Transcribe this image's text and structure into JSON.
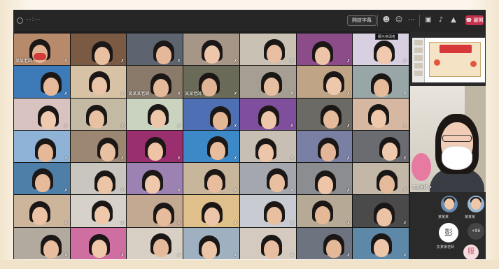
{
  "window": {
    "title": "--:--",
    "top_button": "開啟字幕",
    "leave_label": "離開"
  },
  "tooltip": "顯示參與者",
  "icons": [
    "participants-icon",
    "reactions-icon",
    "more-icon",
    "camera-icon",
    "mic-icon",
    "share-icon",
    "phone-icon"
  ],
  "tiles": [
    {
      "label": "某某老師",
      "bg": "#b88a6c",
      "skin": "#e0b392",
      "mask": true
    },
    {
      "label": "",
      "bg": "#7b5a43",
      "skin": "#e8c0a0"
    },
    {
      "label": "",
      "bg": "#5d6470",
      "skin": "#e6b89a"
    },
    {
      "label": "",
      "bg": "#a59687",
      "skin": "#edc6ab"
    },
    {
      "label": "",
      "bg": "#c8c1b4",
      "skin": "#e9bfa3"
    },
    {
      "label": "",
      "bg": "#8c4c8a",
      "skin": "#eec4a8"
    },
    {
      "label": "",
      "bg": "#d8cfe0",
      "skin": "#f0c9ae"
    },
    {
      "label": "",
      "bg": "#3c7ab8",
      "skin": "#e6b99a"
    },
    {
      "label": "",
      "bg": "#d7c2a6",
      "skin": "#eac4a6"
    },
    {
      "label": "黃某某老師",
      "bg": "#8a7a6a",
      "skin": "#e4ba9b"
    },
    {
      "label": "某某老師",
      "bg": "#6a6a58",
      "skin": "#dfb595"
    },
    {
      "label": "",
      "bg": "#a69e92",
      "skin": "#e7bea0"
    },
    {
      "label": "",
      "bg": "#c0a486",
      "skin": "#eec8ad"
    },
    {
      "label": "",
      "bg": "#98a6a8",
      "skin": "#e6bb9c"
    },
    {
      "label": "",
      "bg": "#d9c3c0",
      "skin": "#f0caaf"
    },
    {
      "label": "",
      "bg": "#c4b9a2",
      "skin": "#e8c0a2"
    },
    {
      "label": "",
      "bg": "#c9d3bf",
      "skin": "#edc5a8"
    },
    {
      "label": "",
      "bg": "#4f6fb4",
      "skin": "#e3b696"
    },
    {
      "label": "",
      "bg": "#7f4e9c",
      "skin": "#eec6a9"
    },
    {
      "label": "",
      "bg": "#6b6a64",
      "skin": "#e6bb9b"
    },
    {
      "label": "",
      "bg": "#d6b8a2",
      "skin": "#efc8ac"
    },
    {
      "label": "",
      "bg": "#8fb3d6",
      "skin": "#e5b898"
    },
    {
      "label": "",
      "bg": "#9c8872",
      "skin": "#e8c0a2"
    },
    {
      "label": "",
      "bg": "#9a2f6f",
      "skin": "#eec3a6"
    },
    {
      "label": "",
      "bg": "#3d88c6",
      "skin": "#e8bd9e"
    },
    {
      "label": "",
      "bg": "#c8bfb4",
      "skin": "#edc6a9"
    },
    {
      "label": "",
      "bg": "#7a7fa4",
      "skin": "#e3b697"
    },
    {
      "label": "",
      "bg": "#6a6c72",
      "skin": "#efc9ad"
    },
    {
      "label": "",
      "bg": "#4e7fa8",
      "skin": "#e6ba9a"
    },
    {
      "label": "",
      "bg": "#c9c6c0",
      "skin": "#ecc4a6"
    },
    {
      "label": "",
      "bg": "#9c82b2",
      "skin": "#f0c8ab"
    },
    {
      "label": "",
      "bg": "#c7b69c",
      "skin": "#e7bd9e"
    },
    {
      "label": "",
      "bg": "#a4a8ae",
      "skin": "#e8bf9f"
    },
    {
      "label": "",
      "bg": "#8c8d90",
      "skin": "#eec5a8"
    },
    {
      "label": "",
      "bg": "#c3b8a8",
      "skin": "#e5ba9a"
    },
    {
      "label": "",
      "bg": "#cdb59c",
      "skin": "#ecc3a5"
    },
    {
      "label": "",
      "bg": "#d6d2ca",
      "skin": "#efc8ab"
    },
    {
      "label": "",
      "bg": "#c3a892",
      "skin": "#e6bc9c"
    },
    {
      "label": "",
      "bg": "#e0c08a",
      "skin": "#edc6a9"
    },
    {
      "label": "",
      "bg": "#c8ccd2",
      "skin": "#e8bf9f"
    },
    {
      "label": "",
      "bg": "#b6a995",
      "skin": "#e5b998"
    },
    {
      "label": "",
      "bg": "#4a4a4a",
      "skin": "#ecc3a5"
    },
    {
      "label": "",
      "bg": "#b2aa9e",
      "skin": "#e7bd9e"
    },
    {
      "label": "",
      "bg": "#cf6ea0",
      "skin": "#efc7aa"
    },
    {
      "label": "",
      "bg": "#d8d0c4",
      "skin": "#e6bb9b"
    },
    {
      "label": "",
      "bg": "#9fb0c0",
      "skin": "#ecc4a6"
    },
    {
      "label": "",
      "bg": "#d4cac0",
      "skin": "#e8bea0"
    },
    {
      "label": "",
      "bg": "#6d7480",
      "skin": "#e5b998"
    },
    {
      "label": "",
      "bg": "#5e88a8",
      "skin": "#edc5a8"
    }
  ],
  "spotlight": {
    "label": "某某老師",
    "mic_off": true
  },
  "side_people": [
    {
      "label": "某某某"
    },
    {
      "label": "某某某"
    }
  ],
  "initial": "彭",
  "initial_label": "彭某某老師",
  "more": "+86",
  "fab_label": "服"
}
